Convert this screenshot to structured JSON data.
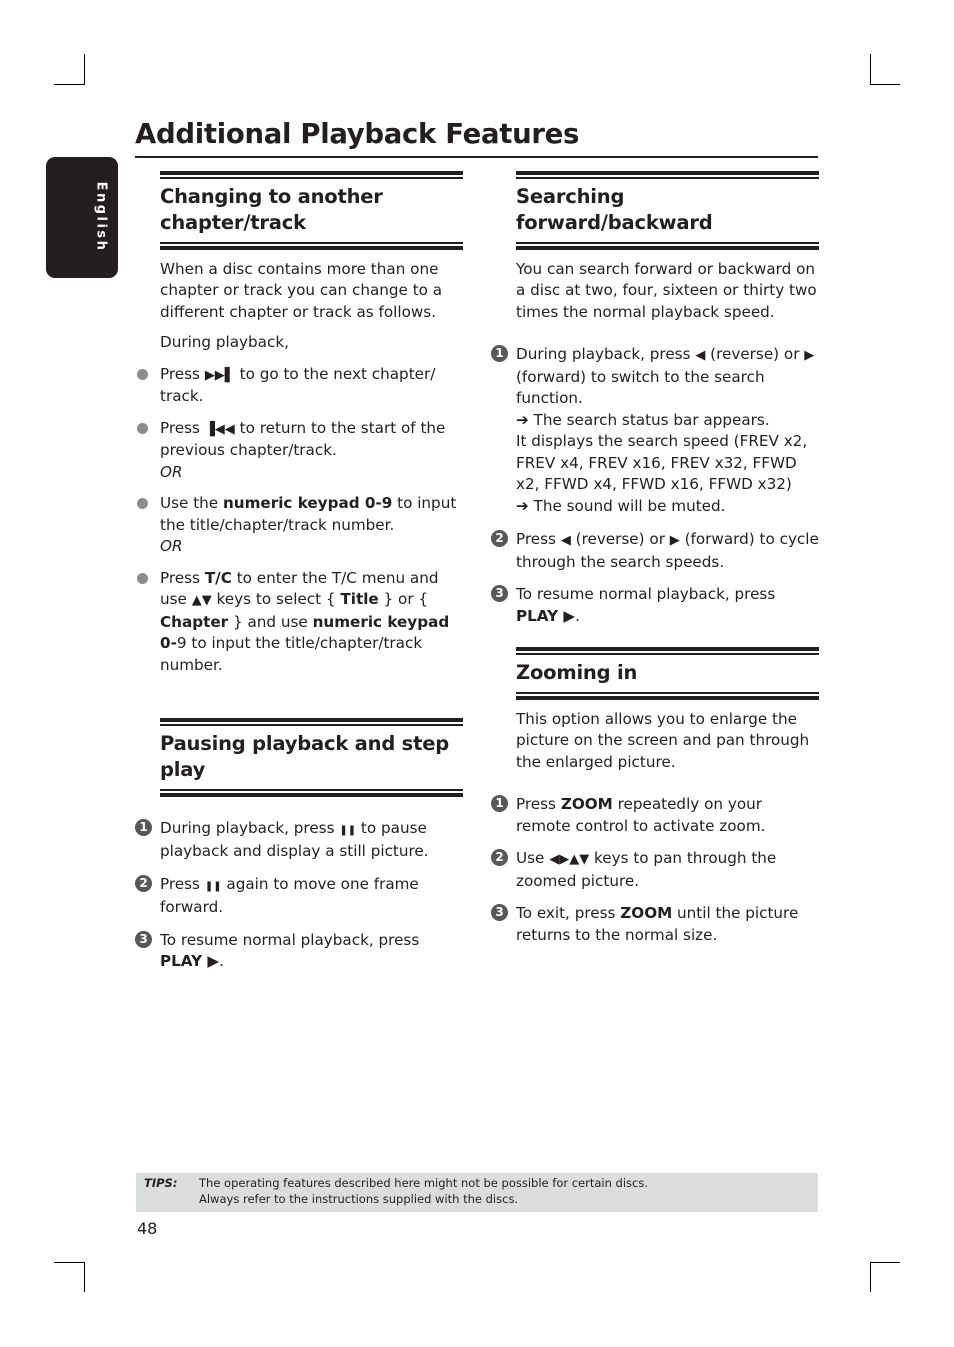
{
  "page": {
    "title": "Additional Playback Features",
    "language_tab": "English",
    "page_number": "48"
  },
  "sections": {
    "changing": {
      "title_line1": "Changing to another",
      "title_line2": "chapter/track",
      "intro": "When a disc contains more than one chapter or track you can change to a different chapter or track as follows.",
      "lead": "During playback,",
      "bullets": [
        {
          "pre": "Press ",
          "icon": "▶▶▌",
          "post": " to go to the next chapter/ track."
        },
        {
          "pre": "Press ",
          "icon": "▐◀◀",
          "post": " to return to the start of the previous chapter/track.",
          "or": "OR"
        },
        {
          "pre": "Use the ",
          "bold": "numeric keypad 0-9",
          "post": " to input the title/chapter/track number.",
          "or": "OR"
        },
        {
          "pre": "Press ",
          "bold1": "T/C",
          "mid1": " to enter the T/C menu and use ",
          "icon": "▲▼",
          "mid2": " keys to select { ",
          "bold2": "Title",
          "mid3": " } or { ",
          "bold3": "Chapter",
          "mid4": " } and use ",
          "bold4": "numeric keypad 0-",
          "mid5": "9 to input the title/chapter/track number."
        }
      ]
    },
    "pausing": {
      "title_line1": "Pausing playback and step",
      "title_line2": "play",
      "steps": [
        {
          "num": "1",
          "pre": "During playback, press ",
          "icon": "❚❚",
          "post": " to pause playback and display a still picture."
        },
        {
          "num": "2",
          "pre": "Press ",
          "icon": "❚❚",
          "post": " again to move one frame forward."
        },
        {
          "num": "3",
          "pre": "To resume normal playback, press ",
          "bold": "PLAY ▶",
          "post": "."
        }
      ]
    },
    "searching": {
      "title": "Searching forward/backward",
      "intro": "You can search forward or backward on a disc at two, four, sixteen or thirty two times the normal playback speed.",
      "steps": [
        {
          "num": "1",
          "pre": "During playback, press ",
          "icon1": "◀",
          "mid": " (reverse) or ",
          "icon2": "▶",
          "post": " (forward) to switch to the search function.",
          "result1": "➔ The search status bar appears.",
          "detail": "It displays the search speed (FREV x2, FREV x4, FREV x16, FREV x32, FFWD x2, FFWD x4, FFWD x16, FFWD x32)",
          "result2": "➔ The sound will be muted."
        },
        {
          "num": "2",
          "pre": "Press ",
          "icon1": "◀",
          "mid": " (reverse) or ",
          "icon2": "▶",
          "post": " (forward) to cycle through the search speeds."
        },
        {
          "num": "3",
          "pre": "To resume normal playback, press ",
          "bold": "PLAY ▶",
          "post": "."
        }
      ]
    },
    "zooming": {
      "title": "Zooming in",
      "intro": "This option allows you to enlarge the picture on the screen and pan through the enlarged picture.",
      "steps": [
        {
          "num": "1",
          "pre": "Press ",
          "bold": "ZOOM",
          "post": " repeatedly on your remote control to activate zoom."
        },
        {
          "num": "2",
          "pre": "Use ",
          "icon": "◀▶▲▼",
          "post": " keys to pan through the zoomed picture."
        },
        {
          "num": "3",
          "pre": "To exit, press ",
          "bold": "ZOOM",
          "post": " until the picture returns to the normal size."
        }
      ]
    }
  },
  "tips": {
    "label": "TIPS:",
    "line1": "The operating features described here might not be possible for certain discs.",
    "line2": "Always refer to the instructions supplied with the discs."
  }
}
